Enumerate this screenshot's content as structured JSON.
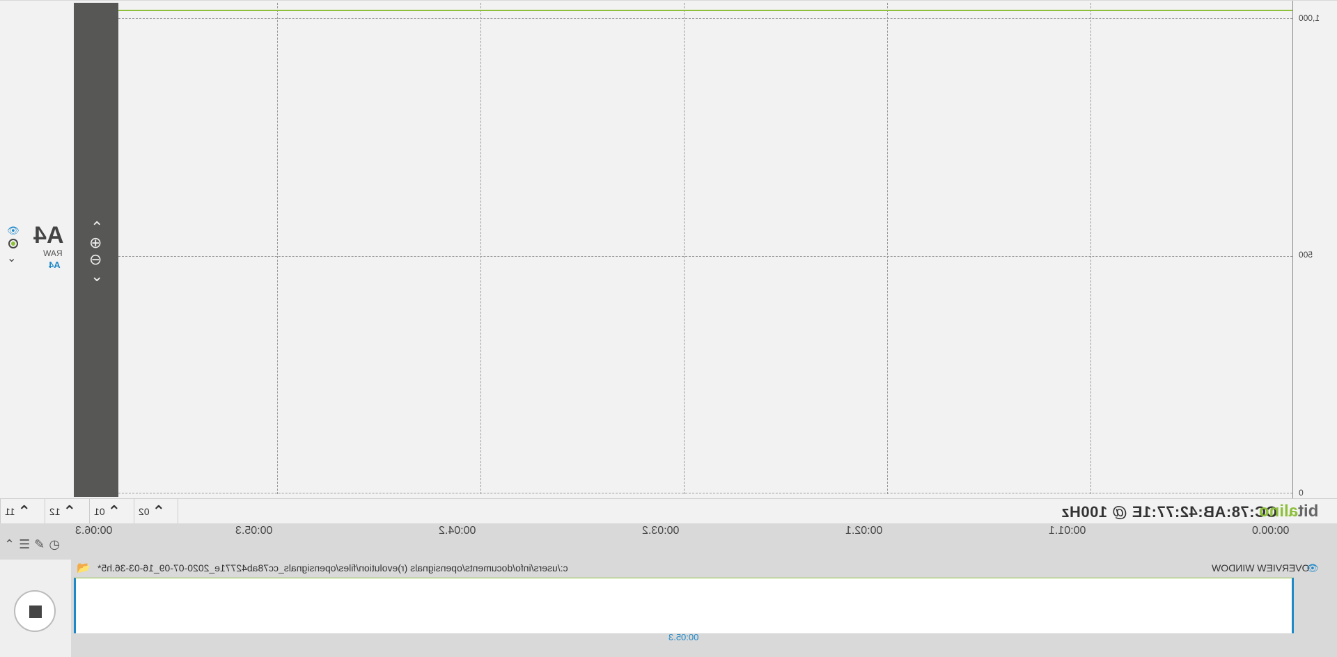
{
  "channel": {
    "title": "A4",
    "type": "RAW",
    "sub_label": "A4"
  },
  "y_axis": {
    "ticks": [
      "1,000",
      "500",
      "0"
    ]
  },
  "device": {
    "label": "CC:78:AB:42:77:1E @ 100Hz"
  },
  "logo": {
    "prefix": "bit",
    "suffix": "alino"
  },
  "controls": [
    {
      "num": "02"
    },
    {
      "num": "01"
    },
    {
      "num": "12"
    },
    {
      "num": "11"
    }
  ],
  "time_axis": {
    "labels": [
      "00:00.0",
      "00:01.1",
      "00:02.1",
      "00:03.2",
      "00:04.2",
      "00:05.3",
      "00:06.3"
    ]
  },
  "overview": {
    "title": "OVERVIEW WINDOW",
    "file_path": "c:/users/info/documents/opensignals (r)evolution/files/opensignals_cc78ab42771e_2020-07-09_16-03-36.h5*",
    "current_time": "00:05.3"
  },
  "colors": {
    "signal": "#8dbf3a",
    "accent": "#1e88c8",
    "zoom_bar": "#575756"
  }
}
